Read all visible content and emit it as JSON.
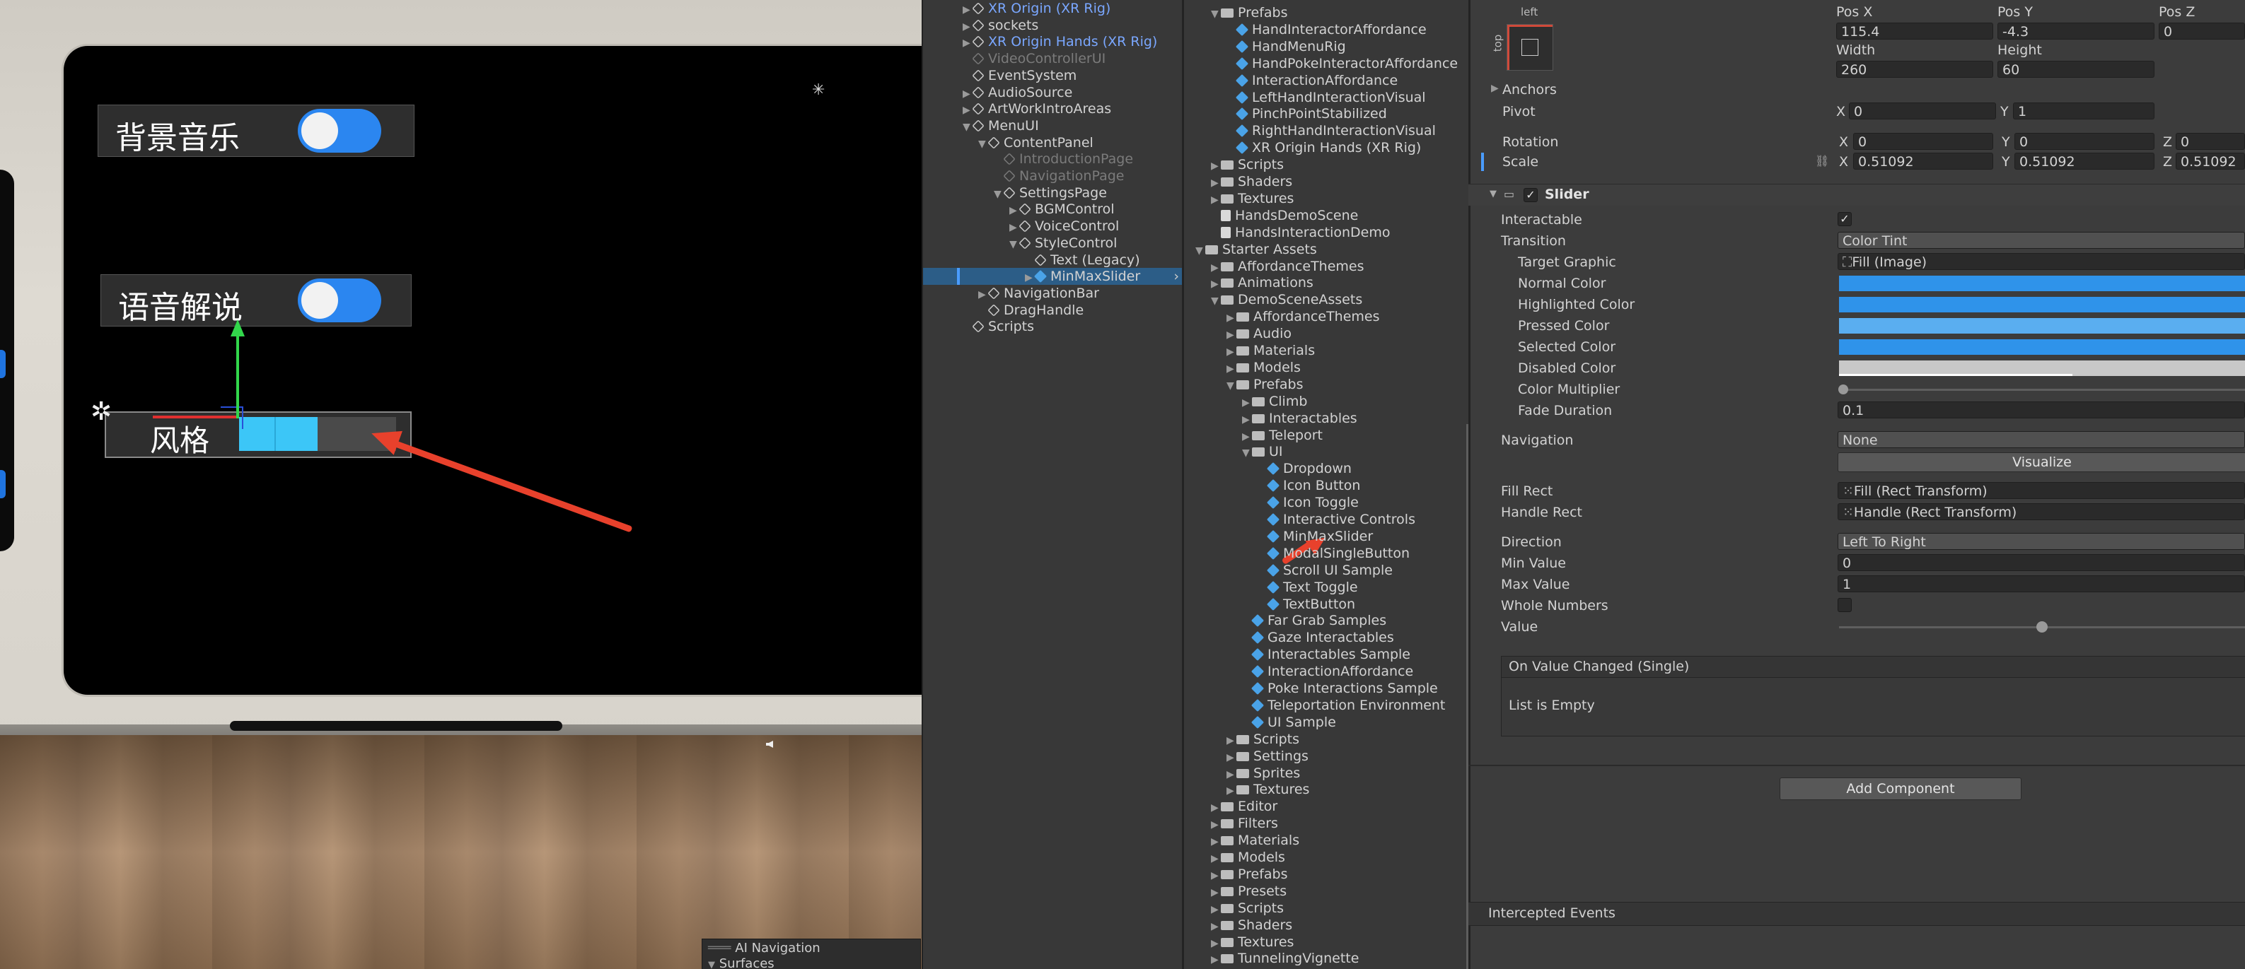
{
  "scene": {
    "menu_rows": [
      {
        "label": "背景音乐",
        "toggle": "on"
      },
      {
        "label": "语音解说",
        "toggle": "on"
      }
    ],
    "style_label": "风格",
    "slider_fill": 0.5,
    "navigation_overlay": {
      "title": "AI Navigation",
      "item": "Surfaces"
    }
  },
  "hierarchy": [
    {
      "label": "XR Origin (XR Rig)",
      "style": "blue",
      "indent": 0,
      "icon": "gameobject-icon"
    },
    {
      "label": "sockets",
      "indent": 0,
      "icon": "gameobject-icon"
    },
    {
      "label": "XR Origin Hands (XR Rig)",
      "style": "blue",
      "indent": 0,
      "icon": "gameobject-icon"
    },
    {
      "label": "VideoControllerUI",
      "style": "dim",
      "indent": 0,
      "icon": "gameobject-icon"
    },
    {
      "label": "EventSystem",
      "indent": 0,
      "icon": "gameobject-icon"
    },
    {
      "label": "AudioSource",
      "indent": 0,
      "icon": "gameobject-icon"
    },
    {
      "label": "ArtWorkIntroAreas",
      "indent": 0,
      "icon": "gameobject-icon"
    },
    {
      "label": "MenuUI",
      "indent": 0,
      "icon": "gameobject-icon"
    },
    {
      "label": "ContentPanel",
      "indent": 1,
      "icon": "gameobject-icon"
    },
    {
      "label": "IntroductionPage",
      "style": "dim",
      "indent": 2,
      "icon": "gameobject-icon"
    },
    {
      "label": "NavigationPage",
      "style": "dim",
      "indent": 2,
      "icon": "gameobject-icon"
    },
    {
      "label": "SettingsPage",
      "indent": 2,
      "icon": "gameobject-icon"
    },
    {
      "label": "BGMControl",
      "indent": 3,
      "icon": "gameobject-icon"
    },
    {
      "label": "VoiceControl",
      "indent": 3,
      "icon": "gameobject-icon"
    },
    {
      "label": "StyleControl",
      "indent": 3,
      "icon": "gameobject-icon"
    },
    {
      "label": "Text (Legacy)",
      "indent": 4,
      "icon": "gameobject-icon"
    },
    {
      "label": "MinMaxSlider",
      "indent": 4,
      "icon": "prefab-icon",
      "selected": true
    },
    {
      "label": "NavigationBar",
      "indent": 1,
      "icon": "gameobject-icon"
    },
    {
      "label": "DragHandle",
      "indent": 1,
      "icon": "gameobject-icon"
    },
    {
      "label": "Scripts",
      "indent": 0,
      "icon": "gameobject-icon"
    }
  ],
  "project": [
    {
      "label": "Prefabs",
      "indent": 1,
      "icon": "folder-icon"
    },
    {
      "label": "HandInteractorAffordance",
      "indent": 2,
      "icon": "prefab-icon"
    },
    {
      "label": "HandMenuRig",
      "indent": 2,
      "icon": "prefab-icon"
    },
    {
      "label": "HandPokeInteractorAffordance",
      "indent": 2,
      "icon": "prefab-icon"
    },
    {
      "label": "InteractionAffordance",
      "indent": 2,
      "icon": "prefab-icon"
    },
    {
      "label": "LeftHandInteractionVisual",
      "indent": 2,
      "icon": "prefab-icon"
    },
    {
      "label": "PinchPointStabilized",
      "indent": 2,
      "icon": "prefab-icon"
    },
    {
      "label": "RightHandInteractionVisual",
      "indent": 2,
      "icon": "prefab-icon"
    },
    {
      "label": "XR Origin Hands (XR Rig)",
      "indent": 2,
      "icon": "prefab-icon"
    },
    {
      "label": "Scripts",
      "indent": 1,
      "icon": "folder-icon"
    },
    {
      "label": "Shaders",
      "indent": 1,
      "icon": "folder-icon"
    },
    {
      "label": "Textures",
      "indent": 1,
      "icon": "folder-icon"
    },
    {
      "label": "HandsDemoScene",
      "indent": 1,
      "icon": "scene-icon"
    },
    {
      "label": "HandsInteractionDemo",
      "indent": 1,
      "icon": "scene-icon"
    },
    {
      "label": "Starter Assets",
      "indent": 0,
      "icon": "folder-icon"
    },
    {
      "label": "AffordanceThemes",
      "indent": 1,
      "icon": "folder-icon"
    },
    {
      "label": "Animations",
      "indent": 1,
      "icon": "folder-icon"
    },
    {
      "label": "DemoSceneAssets",
      "indent": 1,
      "icon": "folder-icon"
    },
    {
      "label": "AffordanceThemes",
      "indent": 2,
      "icon": "folder-icon"
    },
    {
      "label": "Audio",
      "indent": 2,
      "icon": "folder-icon"
    },
    {
      "label": "Materials",
      "indent": 2,
      "icon": "folder-icon"
    },
    {
      "label": "Models",
      "indent": 2,
      "icon": "folder-icon"
    },
    {
      "label": "Prefabs",
      "indent": 2,
      "icon": "folder-icon"
    },
    {
      "label": "Climb",
      "indent": 3,
      "icon": "folder-icon"
    },
    {
      "label": "Interactables",
      "indent": 3,
      "icon": "folder-icon"
    },
    {
      "label": "Teleport",
      "indent": 3,
      "icon": "folder-icon"
    },
    {
      "label": "UI",
      "indent": 3,
      "icon": "folder-icon"
    },
    {
      "label": "Dropdown",
      "indent": 4,
      "icon": "prefab-icon"
    },
    {
      "label": "Icon Button",
      "indent": 4,
      "icon": "prefab-icon"
    },
    {
      "label": "Icon Toggle",
      "indent": 4,
      "icon": "prefab-icon"
    },
    {
      "label": "Interactive Controls",
      "indent": 4,
      "icon": "prefab-icon"
    },
    {
      "label": "MinMaxSlider",
      "indent": 4,
      "icon": "prefab-icon"
    },
    {
      "label": "ModalSingleButton",
      "indent": 4,
      "icon": "prefab-icon"
    },
    {
      "label": "Scroll UI Sample",
      "indent": 4,
      "icon": "prefab-icon"
    },
    {
      "label": "Text Toggle",
      "indent": 4,
      "icon": "prefab-icon"
    },
    {
      "label": "TextButton",
      "indent": 4,
      "icon": "prefab-icon"
    },
    {
      "label": "Far Grab Samples",
      "indent": 3,
      "icon": "prefab-icon"
    },
    {
      "label": "Gaze Interactables",
      "indent": 3,
      "icon": "prefab-icon"
    },
    {
      "label": "Interactables Sample",
      "indent": 3,
      "icon": "prefab-icon"
    },
    {
      "label": "InteractionAffordance",
      "indent": 3,
      "icon": "prefab-icon"
    },
    {
      "label": "Poke Interactions Sample",
      "indent": 3,
      "icon": "prefab-icon"
    },
    {
      "label": "Teleportation Environment",
      "indent": 3,
      "icon": "prefab-icon"
    },
    {
      "label": "UI Sample",
      "indent": 3,
      "icon": "prefab-icon"
    },
    {
      "label": "Scripts",
      "indent": 2,
      "icon": "folder-icon"
    },
    {
      "label": "Settings",
      "indent": 2,
      "icon": "folder-icon"
    },
    {
      "label": "Sprites",
      "indent": 2,
      "icon": "folder-icon"
    },
    {
      "label": "Textures",
      "indent": 2,
      "icon": "folder-icon"
    },
    {
      "label": "Editor",
      "indent": 1,
      "icon": "folder-icon"
    },
    {
      "label": "Filters",
      "indent": 1,
      "icon": "folder-icon"
    },
    {
      "label": "Materials",
      "indent": 1,
      "icon": "folder-icon"
    },
    {
      "label": "Models",
      "indent": 1,
      "icon": "folder-icon"
    },
    {
      "label": "Prefabs",
      "indent": 1,
      "icon": "folder-icon"
    },
    {
      "label": "Presets",
      "indent": 1,
      "icon": "folder-icon"
    },
    {
      "label": "Scripts",
      "indent": 1,
      "icon": "folder-icon"
    },
    {
      "label": "Shaders",
      "indent": 1,
      "icon": "folder-icon"
    },
    {
      "label": "Textures",
      "indent": 1,
      "icon": "folder-icon"
    },
    {
      "label": "TunnelingVignette",
      "indent": 1,
      "icon": "folder-icon"
    }
  ],
  "inspector": {
    "anchor_preset": {
      "h": "left",
      "v": "top"
    },
    "rect": {
      "pos_x_label": "Pos X",
      "pos_y_label": "Pos Y",
      "pos_z_label": "Pos Z",
      "pos_x": "115.4",
      "pos_y": "-4.3",
      "pos_z": "0",
      "width_label": "Width",
      "height_label": "Height",
      "width": "260",
      "height": "60"
    },
    "anchors_label": "Anchors",
    "pivot_label": "Pivot",
    "pivot_x": "0",
    "pivot_y": "1",
    "rotation_label": "Rotation",
    "rot_x": "0",
    "rot_y": "0",
    "rot_z": "0",
    "scale_label": "Scale",
    "scale_x": "0.51092",
    "scale_y": "0.51092",
    "scale_z": "0.51092",
    "axis": {
      "x": "X",
      "y": "Y",
      "z": "Z"
    },
    "slider_title": "Slider",
    "fields": {
      "interactable": "Interactable",
      "transition": "Transition",
      "transition_value": "Color Tint",
      "target_graphic": "Target Graphic",
      "target_graphic_value": "Fill (Image)",
      "normal_color": "Normal Color",
      "highlighted_color": "Highlighted Color",
      "pressed_color": "Pressed Color",
      "selected_color": "Selected Color",
      "disabled_color": "Disabled Color",
      "color_multiplier": "Color Multiplier",
      "fade_duration": "Fade Duration",
      "fade_duration_value": "0.1",
      "navigation": "Navigation",
      "navigation_value": "None",
      "visualize": "Visualize",
      "fill_rect": "Fill Rect",
      "fill_rect_value": "Fill (Rect Transform)",
      "handle_rect": "Handle Rect",
      "handle_rect_value": "Handle (Rect Transform)",
      "direction": "Direction",
      "direction_value": "Left To Right",
      "min_value": "Min Value",
      "min_value_value": "0",
      "max_value": "Max Value",
      "max_value_value": "1",
      "whole_numbers": "Whole Numbers",
      "value": "Value"
    },
    "event_title": "On Value Changed (Single)",
    "event_empty": "List is Empty",
    "add_component": "Add Component",
    "intercepted_events": "Intercepted Events",
    "colors": {
      "normal": "#2f93ea",
      "highlighted": "#2f93ea",
      "pressed": "#5aaef0",
      "selected": "#2f93ea",
      "disabled": "#c8c8c8"
    },
    "value_fraction": 0.5
  },
  "colors": {
    "accent": "#2b86f0",
    "selection": "#2c5d87",
    "arrow": "#e8412c"
  }
}
